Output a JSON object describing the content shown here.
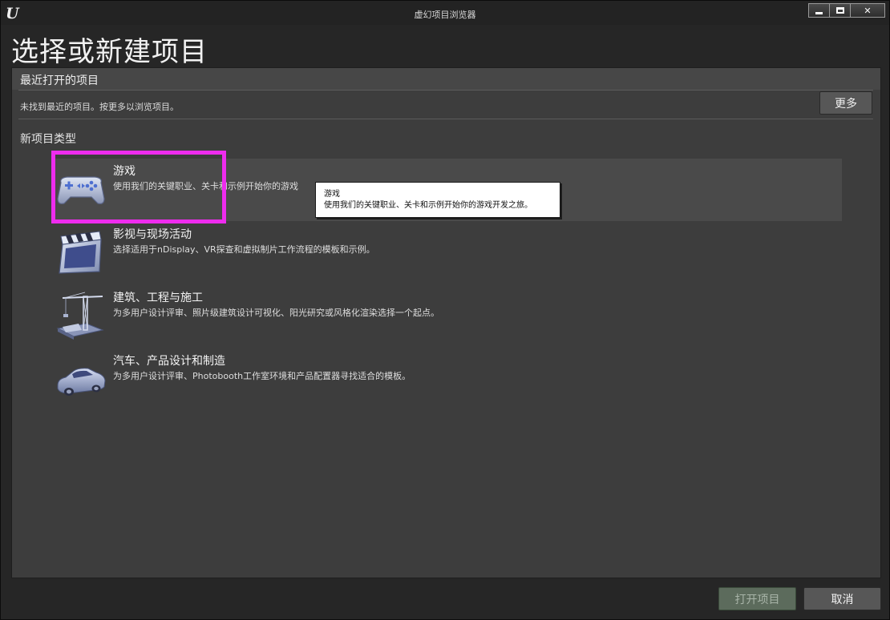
{
  "window": {
    "title": "虚幻项目浏览器",
    "close_glyph": "✕"
  },
  "page_title": "选择或新建项目",
  "recent": {
    "title": "最近打开的项目",
    "empty_message": "未找到最近的项目。按更多以浏览项目。",
    "more_label": "更多"
  },
  "project_types": {
    "title": "新项目类型",
    "items": [
      {
        "name": "游戏",
        "description": "使用我们的关键职业、关卡和示例开始你的游戏",
        "icon": "gamepad-icon"
      },
      {
        "name": "影视与现场活动",
        "description": "选择适用于nDisplay、VR探查和虚拟制片工作流程的模板和示例。",
        "icon": "clapperboard-icon"
      },
      {
        "name": "建筑、工程与施工",
        "description": "为多用户设计评审、照片级建筑设计可视化、阳光研究或风格化渲染选择一个起点。",
        "icon": "crane-icon"
      },
      {
        "name": "汽车、产品设计和制造",
        "description": "为多用户设计评审、Photobooth工作室环境和产品配置器寻找适合的模板。",
        "icon": "car-icon"
      }
    ]
  },
  "tooltip": {
    "title": "游戏",
    "body": "使用我们的关键职业、关卡和示例开始你的游戏开发之旅。"
  },
  "footer": {
    "open_label": "打开项目",
    "cancel_label": "取消"
  },
  "colors": {
    "highlight": "#ee2cee",
    "panel": "#3d3d3d",
    "selected_row": "#4a4a4a"
  }
}
